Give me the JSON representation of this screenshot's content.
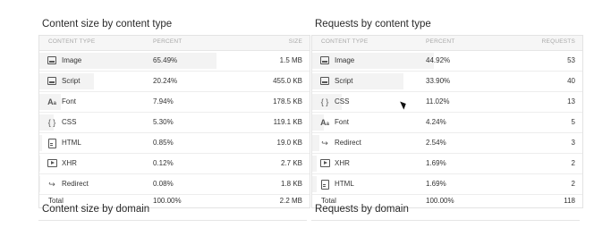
{
  "left": {
    "title": "Content size by content type",
    "subtitle": "Content size by domain",
    "headers": [
      "CONTENT TYPE",
      "PERCENT",
      "SIZE"
    ],
    "rows": [
      {
        "icon": "image-icon",
        "label": "Image",
        "percent": "65.49%",
        "value": "1.5 MB",
        "share": 0.6549
      },
      {
        "icon": "script-icon",
        "label": "Script",
        "percent": "20.24%",
        "value": "455.0 KB",
        "share": 0.2024
      },
      {
        "icon": "font-icon",
        "label": "Font",
        "percent": "7.94%",
        "value": "178.5 KB",
        "share": 0.0794
      },
      {
        "icon": "css-braces-icon",
        "label": "CSS",
        "percent": "5.30%",
        "value": "119.1 KB",
        "share": 0.053
      },
      {
        "icon": "html-document-icon",
        "label": "HTML",
        "percent": "0.85%",
        "value": "19.0 KB",
        "share": 0.0085
      },
      {
        "icon": "xhr-icon",
        "label": "XHR",
        "percent": "0.12%",
        "value": "2.7 KB",
        "share": 0.0012
      },
      {
        "icon": "redirect-icon",
        "label": "Redirect",
        "percent": "0.08%",
        "value": "1.8 KB",
        "share": 0.0008
      }
    ],
    "total": {
      "label": "Total",
      "percent": "100.00%",
      "value": "2.2 MB"
    }
  },
  "right": {
    "title": "Requests by content type",
    "subtitle": "Requests by domain",
    "headers": [
      "CONTENT TYPE",
      "PERCENT",
      "REQUESTS"
    ],
    "rows": [
      {
        "icon": "image-icon",
        "label": "Image",
        "percent": "44.92%",
        "value": "53",
        "share": 0.4492
      },
      {
        "icon": "script-icon",
        "label": "Script",
        "percent": "33.90%",
        "value": "40",
        "share": 0.339
      },
      {
        "icon": "css-braces-icon",
        "label": "CSS",
        "percent": "11.02%",
        "value": "13",
        "share": 0.1102
      },
      {
        "icon": "font-icon",
        "label": "Font",
        "percent": "4.24%",
        "value": "5",
        "share": 0.0424
      },
      {
        "icon": "redirect-icon",
        "label": "Redirect",
        "percent": "2.54%",
        "value": "3",
        "share": 0.0254
      },
      {
        "icon": "xhr-icon",
        "label": "XHR",
        "percent": "1.69%",
        "value": "2",
        "share": 0.0169
      },
      {
        "icon": "html-document-icon",
        "label": "HTML",
        "percent": "1.69%",
        "value": "2",
        "share": 0.0169
      }
    ],
    "total": {
      "label": "Total",
      "percent": "100.00%",
      "value": "118"
    }
  },
  "colors": {
    "bar": "#f3f3f3",
    "border": "#e3e3e3",
    "header_text": "#a8a8a8"
  }
}
